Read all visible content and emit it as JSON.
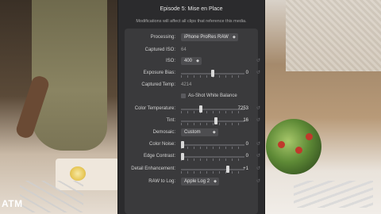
{
  "overlay": {
    "logo": "ATM"
  },
  "panel": {
    "title": "Episode 5: Mise en Place",
    "subtitle": "Modifications will affect all clips that reference this media.",
    "rows": {
      "processing": {
        "label": "Processing:",
        "value": "iPhone ProRes RAW"
      },
      "captured_iso": {
        "label": "Captured ISO:",
        "value": "64"
      },
      "iso": {
        "label": "ISO:",
        "value": "400"
      },
      "exposure_bias": {
        "label": "Exposure Bias:",
        "value": "0",
        "level": 0.5
      },
      "captured_temp": {
        "label": "Captured Temp:",
        "value": "4214"
      },
      "as_shot_wb": {
        "label": "As-Shot White Balance",
        "checked": false
      },
      "color_temperature": {
        "label": "Color Temperature:",
        "value": "7253",
        "level": 0.3
      },
      "tint": {
        "label": "Tint:",
        "value": "16",
        "level": 0.55
      },
      "demosaic": {
        "label": "Demosaic:",
        "value": "Custom"
      },
      "color_noise": {
        "label": "Color Noise:",
        "value": "0",
        "level": 0.0
      },
      "edge_contrast": {
        "label": "Edge Contrast:",
        "value": "0",
        "level": 0.0
      },
      "detail_enhancement": {
        "label": "Detail Enhancement:",
        "value": "+1",
        "level": 0.75
      },
      "raw_to_log": {
        "label": "RAW to Log:",
        "value": "Apple Log 2"
      }
    },
    "reset_glyph": "↺"
  }
}
